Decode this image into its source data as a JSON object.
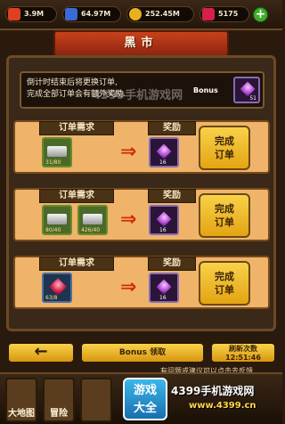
{
  "resources": {
    "r1": {
      "value": "3.9M",
      "icon": "coin-stack-icon",
      "color": "#e04020"
    },
    "r2": {
      "value": "64.97M",
      "icon": "energy-icon",
      "color": "#3a6ad8"
    },
    "r3": {
      "value": "252.45M",
      "icon": "gold-coin-icon",
      "color": "#e8b020"
    },
    "r4": {
      "value": "5175",
      "icon": "ruby-icon",
      "color": "#d61f4a"
    }
  },
  "title": "黑市",
  "bonus": {
    "text_line1": "倒计时结束后将更换订单,",
    "text_line2": "完成全部订单会有额外奖励.",
    "label": "Bonus",
    "reward_qty": "51"
  },
  "orders": [
    {
      "req_label": "订单需求",
      "rew_label": "奖励",
      "items": [
        {
          "type": "silver-bar",
          "count": "31/80"
        }
      ],
      "reward_qty": "16",
      "button": "完成\n订单"
    },
    {
      "req_label": "订单需求",
      "rew_label": "奖励",
      "items": [
        {
          "type": "silver-bar",
          "count": "80/40"
        },
        {
          "type": "silver-bar",
          "count": "426/40"
        }
      ],
      "reward_qty": "16",
      "button": "完成\n订单"
    },
    {
      "req_label": "订单需求",
      "rew_label": "奖励",
      "items": [
        {
          "type": "ruby",
          "count": "63/8"
        }
      ],
      "reward_qty": "16",
      "button": "完成\n订单"
    }
  ],
  "buttons": {
    "back": "←",
    "claim": "Bonus 领取",
    "refresh_line1": "刷新次数",
    "refresh_line2": "12:51:46"
  },
  "feedback": "有问题或建议可以点击去反馈",
  "nav": {
    "map": "大地图",
    "adventure": "冒险"
  },
  "watermark": {
    "wm": "4399手机游戏网",
    "logo1": "游戏",
    "logo2": "大全",
    "brand": "4399手机游戏网",
    "url": "www.4399.cn"
  }
}
